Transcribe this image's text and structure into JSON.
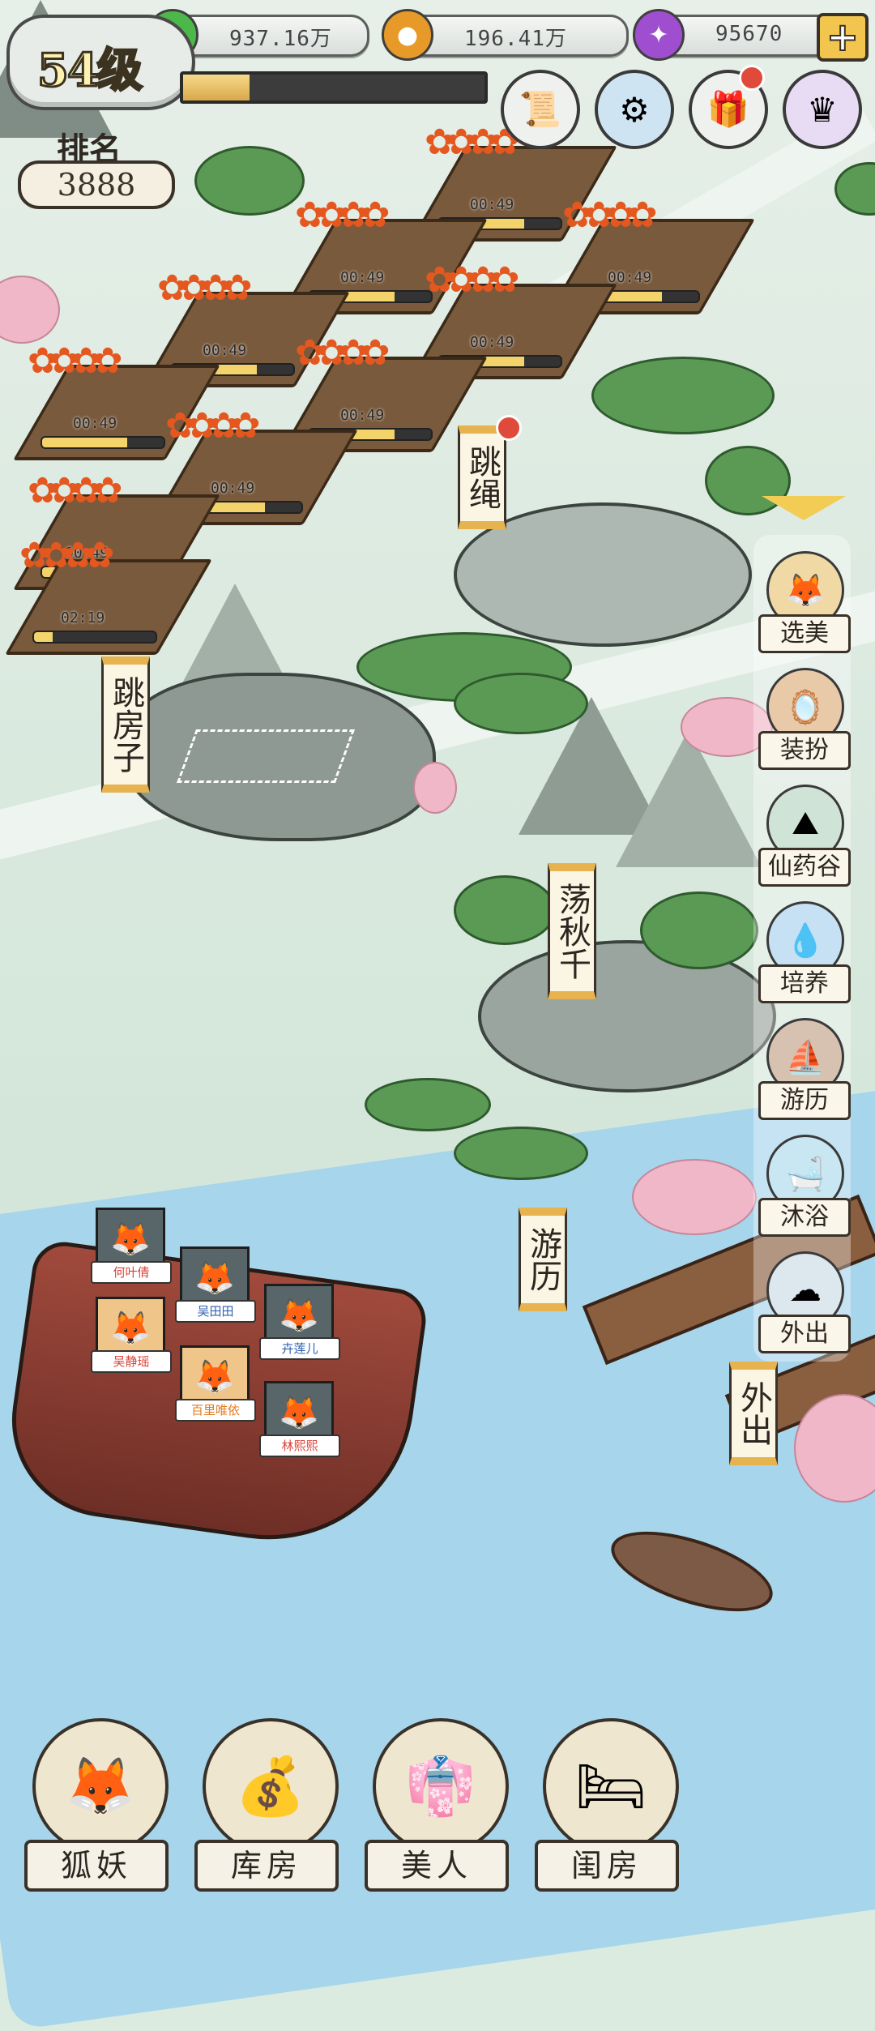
{
  "hud": {
    "resources": [
      {
        "icon": "jade-gem-icon",
        "value": "937.16万"
      },
      {
        "icon": "gold-coin-icon",
        "value": "196.41万"
      },
      {
        "icon": "purple-crystal-icon",
        "value": "95670"
      }
    ],
    "add_label": "+",
    "level": "54级",
    "xp_progress": 0.22,
    "rank_label": "排名",
    "rank_value": "3888"
  },
  "garden_plots": [
    {
      "timer": "00:49"
    },
    {
      "timer": "00:49"
    },
    {
      "timer": "00:49"
    },
    {
      "timer": "00:49"
    },
    {
      "timer": "00:49"
    },
    {
      "timer": "00:49"
    },
    {
      "timer": "00:49"
    },
    {
      "timer": "00:49"
    },
    {
      "timer": "00:49"
    },
    {
      "timer": "02:19"
    }
  ],
  "map_locations": {
    "jump_rope": "跳绳",
    "hopscotch": "跳房子",
    "swing": "荡秋千",
    "travel": "游历",
    "outing": "外出"
  },
  "side_menu": [
    {
      "label": "选美",
      "icon": "fox-mask-icon"
    },
    {
      "label": "装扮",
      "icon": "vanity-mirror-icon"
    },
    {
      "label": "仙药谷",
      "icon": "mountain-valley-icon"
    },
    {
      "label": "培养",
      "icon": "spirit-flame-icon"
    },
    {
      "label": "游历",
      "icon": "boat-icon"
    },
    {
      "label": "沐浴",
      "icon": "bath-tub-icon"
    },
    {
      "label": "外出",
      "icon": "cloud-mountain-icon"
    }
  ],
  "boat_characters": [
    {
      "name": "何叶倩",
      "color": "#d9433a"
    },
    {
      "name": "吴田田",
      "color": "#2f5fae"
    },
    {
      "name": "卉莲儿",
      "color": "#2f5fae"
    },
    {
      "name": "吴静瑶",
      "color": "#d9433a"
    },
    {
      "name": "百里唯依",
      "color": "#e07a1a"
    },
    {
      "name": "林熙熙",
      "color": "#d9433a"
    }
  ],
  "bottom_nav": [
    {
      "label": "狐妖",
      "icon": "white-fox-icon"
    },
    {
      "label": "库房",
      "icon": "treasure-sack-icon"
    },
    {
      "label": "美人",
      "icon": "beauty-portrait-icon"
    },
    {
      "label": "闺房",
      "icon": "chamber-bed-icon"
    }
  ],
  "colors": {
    "accent": "#e6b34e",
    "notification": "#e04a3a",
    "river": "#a7d5ec"
  }
}
